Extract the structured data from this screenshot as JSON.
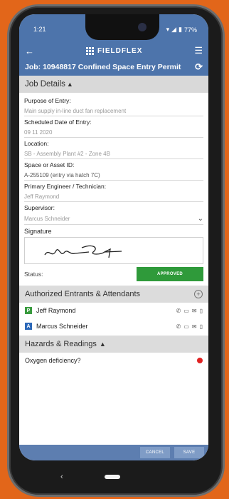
{
  "status_bar": {
    "time": "1:21",
    "battery": "77%"
  },
  "app": {
    "name": "FIELDFLEX"
  },
  "job": {
    "title": "Job: 10948817 Confined Space Entry Permit"
  },
  "job_details": {
    "header": "Job Details",
    "fields": [
      {
        "label": "Purpose of Entry:",
        "value": "Main supply in-line duct fan replacement"
      },
      {
        "label": "Scheduled Date of Entry:",
        "value": "09 11 2020"
      },
      {
        "label": "Location:",
        "value": "SB - Assembly Plant #2 - Zone 4B"
      },
      {
        "label": "Space or Asset ID:",
        "value": "A-255109 (entry via hatch 7C)"
      },
      {
        "label": "Primary Engineer / Technician:",
        "value": "Jeff Raymond"
      },
      {
        "label": "Supervisor:",
        "value": "Marcus Schneider"
      }
    ],
    "signature_label": "Signature",
    "status_label": "Status:",
    "status_value": "APPROVED"
  },
  "entrants": {
    "header": "Authorized Entrants & Attendants",
    "items": [
      {
        "badge": "P",
        "name": "Jeff Raymond"
      },
      {
        "badge": "A",
        "name": "Marcus Schneider"
      }
    ]
  },
  "hazards": {
    "header": "Hazards & Readings",
    "items": [
      {
        "label": "Oxygen deficiency?"
      }
    ]
  },
  "footer": {
    "cancel": "CANCEL",
    "save": "SAVE"
  },
  "colors": {
    "brand": "#4d74ab",
    "approved": "#2f9a3a",
    "alert": "#e02222",
    "background": "#e2661a"
  }
}
